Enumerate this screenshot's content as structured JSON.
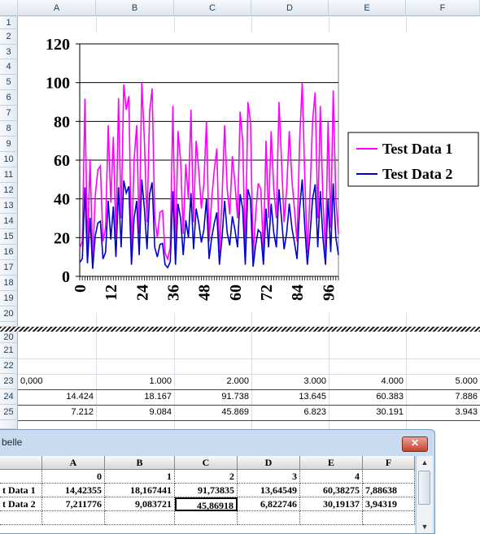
{
  "sheet": {
    "columns": [
      "A",
      "B",
      "C",
      "D",
      "E",
      "F"
    ],
    "rows": [
      "1",
      "2",
      "3",
      "4",
      "5",
      "6",
      "7",
      "8",
      "9",
      "10",
      "11",
      "12",
      "13",
      "14",
      "15",
      "16",
      "17",
      "18",
      "19",
      "20",
      "21",
      "22",
      "23",
      "24",
      "25"
    ],
    "row23": [
      "0,000",
      "1.000",
      "2.000",
      "3.000",
      "4.000",
      "5.000"
    ],
    "row24": [
      "14.424",
      "18.167",
      "91.738",
      "13.645",
      "60.383",
      "7.886"
    ],
    "row25": [
      "7.212",
      "9.084",
      "45.869",
      "6.823",
      "30.191",
      "3.943"
    ]
  },
  "chart_data": {
    "type": "line",
    "ylim": [
      0,
      120
    ],
    "yticks": [
      "0",
      "20",
      "40",
      "60",
      "80",
      "100",
      "120"
    ],
    "xlim": [
      0,
      100
    ],
    "xticks": [
      "0",
      "12",
      "24",
      "36",
      "48",
      "60",
      "72",
      "84",
      "96"
    ],
    "grid": true,
    "legend_position": "right",
    "colors": {
      "Test Data 1": "#ff00ff",
      "Test Data 2": "#0000cc"
    },
    "series": [
      {
        "name": "Test Data 1",
        "values": [
          14.4,
          18.2,
          91.7,
          13.6,
          60.4,
          7.9,
          42,
          55,
          57,
          18,
          25,
          78,
          38,
          72,
          20,
          92,
          30,
          99,
          86,
          93,
          12,
          60,
          78,
          22,
          100,
          70,
          28,
          85,
          97,
          30,
          20,
          33,
          34,
          12,
          9,
          15,
          88,
          12,
          75,
          60,
          22,
          58,
          40,
          86,
          28,
          70,
          55,
          35,
          48,
          80,
          18,
          40,
          55,
          66,
          12,
          40,
          78,
          45,
          32,
          62,
          48,
          30,
          85,
          70,
          12,
          90,
          80,
          10,
          32,
          48,
          45,
          12,
          70,
          30,
          75,
          45,
          30,
          90,
          60,
          28,
          45,
          75,
          50,
          35,
          18,
          70,
          100,
          50,
          12,
          42,
          80,
          95,
          30,
          88,
          40,
          12,
          80,
          25,
          96,
          40,
          22
        ]
      },
      {
        "name": "Test Data 2",
        "values": [
          7.2,
          9.1,
          45.9,
          6.8,
          30.2,
          3.9,
          21,
          27.5,
          28.5,
          9,
          12.5,
          39,
          19,
          36,
          10,
          46,
          15,
          49.5,
          43,
          46.5,
          6,
          30,
          39,
          11,
          50,
          35,
          14,
          42.5,
          48.5,
          15,
          10,
          16.5,
          17,
          6,
          4.5,
          7.5,
          44,
          6,
          37.5,
          30,
          11,
          29,
          20,
          43,
          14,
          35,
          27.5,
          17.5,
          24,
          40,
          9,
          20,
          27.5,
          33,
          6,
          20,
          39,
          22.5,
          16,
          31,
          24,
          15,
          42.5,
          35,
          6,
          45,
          40,
          5,
          16,
          24,
          22.5,
          6,
          35,
          15,
          37.5,
          22.5,
          15,
          45,
          30,
          14,
          22.5,
          37.5,
          25,
          17.5,
          9,
          35,
          50,
          25,
          6,
          21,
          40,
          47.5,
          15,
          44,
          20,
          6,
          40,
          12.5,
          48,
          20,
          11
        ]
      }
    ]
  },
  "window": {
    "title": "belle",
    "close_label": "✕",
    "col_headers": [
      "A",
      "B",
      "C",
      "D",
      "E",
      "F"
    ],
    "row_header": [
      "0",
      "1",
      "2",
      "3",
      "4"
    ],
    "row1_label": "t Data 1",
    "row1": [
      "14,42355",
      "18,167441",
      "91,73835",
      "13,64549",
      "60,38275",
      "7,88638"
    ],
    "row2_label": "t Data 2",
    "row2": [
      "7,211776",
      "9,083721",
      "45,86918",
      "6,822746",
      "30,19137",
      "3,94319"
    ]
  }
}
